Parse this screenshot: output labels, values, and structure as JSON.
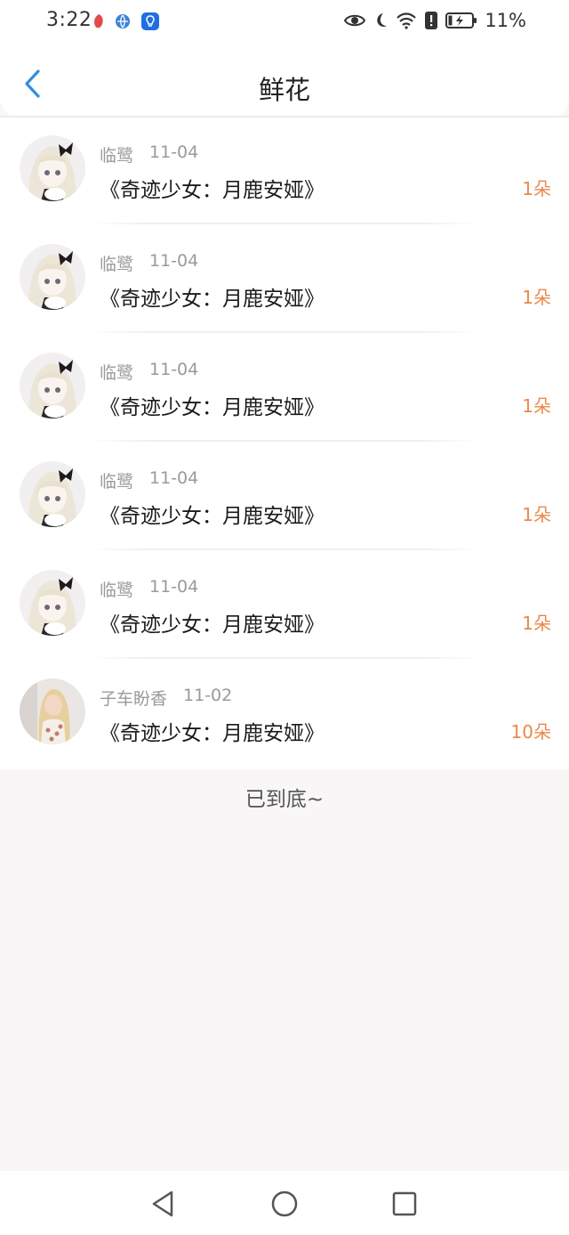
{
  "status_bar": {
    "time": "3:22",
    "battery": "11%",
    "icons": [
      "notification-app-icon",
      "network-app-icon",
      "bulb-app-icon",
      "eye-icon",
      "moon-icon",
      "wifi-icon",
      "alert-icon",
      "battery-charging-icon"
    ]
  },
  "header": {
    "title": "鲜花",
    "back_icon": "chevron-left-icon"
  },
  "rows": [
    {
      "user": "临鹭",
      "date": "11-04",
      "title": "《奇迹少女：月鹿安娅》",
      "amount": "1朵"
    },
    {
      "user": "临鹭",
      "date": "11-04",
      "title": "《奇迹少女：月鹿安娅》",
      "amount": "1朵"
    },
    {
      "user": "临鹭",
      "date": "11-04",
      "title": "《奇迹少女：月鹿安娅》",
      "amount": "1朵"
    },
    {
      "user": "临鹭",
      "date": "11-04",
      "title": "《奇迹少女：月鹿安娅》",
      "amount": "1朵"
    },
    {
      "user": "临鹭",
      "date": "11-04",
      "title": "《奇迹少女：月鹿安娅》",
      "amount": "1朵"
    },
    {
      "user": "子车盼香",
      "date": "11-02",
      "title": "《奇迹少女：月鹿安娅》",
      "amount": "10朵"
    }
  ],
  "end_text": "已到底~",
  "colors": {
    "accent_blue": "#2f8fe0",
    "amount_orange": "#e9894a",
    "page_bg": "#f8f6f7"
  },
  "nav_bar": {
    "icons": [
      "back-triangle-icon",
      "home-circle-icon",
      "recents-square-icon"
    ]
  }
}
